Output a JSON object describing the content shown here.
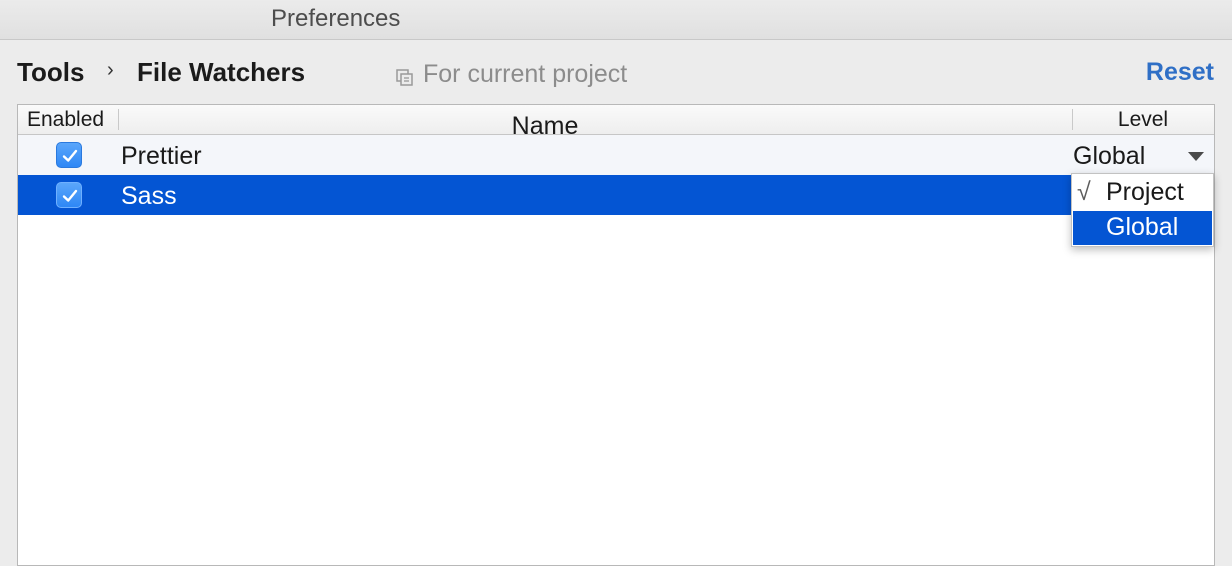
{
  "window": {
    "title": "Preferences"
  },
  "breadcrumb": {
    "parent": "Tools",
    "separator": "›",
    "current": "File Watchers"
  },
  "scope": {
    "label": "For current project",
    "icon": "project-scope-icon"
  },
  "header": {
    "reset_label": "Reset"
  },
  "table": {
    "columns": {
      "enabled": "Enabled",
      "name": "Name",
      "level": "Level"
    },
    "rows": [
      {
        "enabled": true,
        "name": "Prettier",
        "level": "Global"
      },
      {
        "enabled": true,
        "name": "Sass",
        "level": ""
      }
    ]
  },
  "level_dropdown": {
    "options": [
      {
        "label": "Project",
        "checked": true
      },
      {
        "label": "Global",
        "highlighted": true
      }
    ],
    "check_glyph": "√"
  },
  "colors": {
    "accent": "#2f6fc6",
    "selection": "#0455d3",
    "checkbox": "#3b8ff7"
  }
}
